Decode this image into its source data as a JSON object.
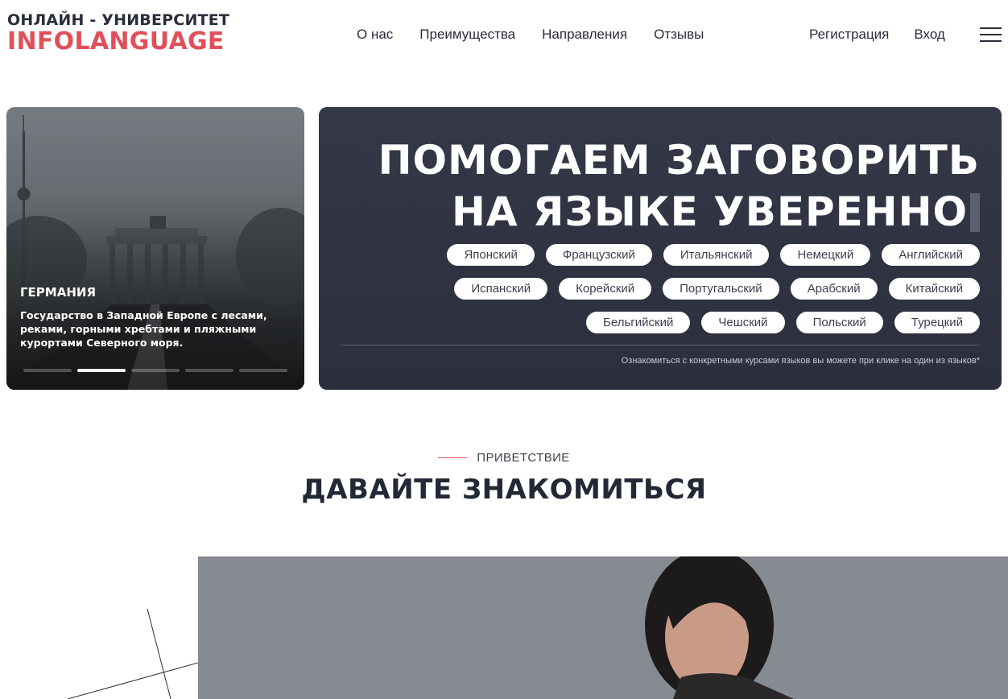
{
  "header": {
    "logo_top": "ОНЛАЙН - УНИВЕРСИТЕТ",
    "logo_bottom": "INFOLANGUAGE",
    "nav": [
      "О нас",
      "Преимущества",
      "Направления",
      "Отзывы"
    ],
    "register": "Регистрация",
    "login": "Вход",
    "menu_icon": "hamburger-icon"
  },
  "slider": {
    "title": "ГЕРМАНИЯ",
    "text": "Государство в Западной Европе с лесами, реками, горными хребтами и пляжными курортами Северного моря.",
    "slides_total": 5,
    "active_slide": 2
  },
  "hero": {
    "title_line1": "ПОМОГАЕМ ЗАГОВОРИТЬ",
    "title_line2": "НА ЯЗЫКЕ УВЕРЕННО",
    "languages_row1": [
      "Японский",
      "Французский",
      "Итальянский",
      "Немецкий",
      "Английский"
    ],
    "languages_row2": [
      "Испанский",
      "Корейский",
      "Португальский",
      "Арабский",
      "Китайский"
    ],
    "languages_row3": [
      "Бельгийский",
      "Чешский",
      "Польский",
      "Турецкий"
    ],
    "note": "Ознакомиться с конкретными курсами языков вы можете при клике на один из языков*"
  },
  "greeting": {
    "label": "ПРИВЕТСТВИЕ",
    "title": "ДАВАЙТЕ ЗНАКОМИТЬСЯ"
  },
  "colors": {
    "brand_red": "#e0505a",
    "hero_bg": "#2f3241",
    "text_dark": "#232836"
  }
}
